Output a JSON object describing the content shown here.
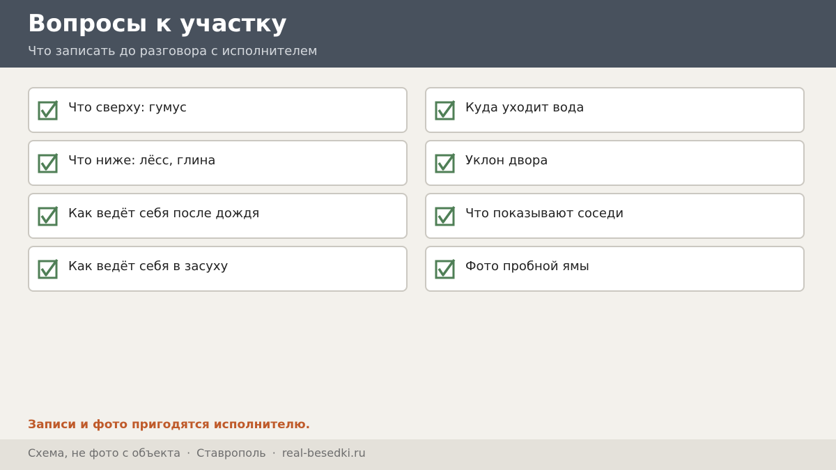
{
  "header": {
    "title": "Вопросы к участку",
    "subtitle": "Что записать до разговора с исполнителем"
  },
  "checklist": {
    "left": [
      {
        "label": "Что сверху: гумус",
        "checked": true
      },
      {
        "label": "Что ниже: лёсс, глина",
        "checked": true
      },
      {
        "label": "Как ведёт себя после дождя",
        "checked": true
      },
      {
        "label": "Как ведёт себя в засуху",
        "checked": true
      }
    ],
    "right": [
      {
        "label": "Куда уходит вода",
        "checked": true
      },
      {
        "label": "Уклон двора",
        "checked": true
      },
      {
        "label": "Что показывают соседи",
        "checked": true
      },
      {
        "label": "Фото пробной ямы",
        "checked": true
      }
    ],
    "check_icon": "checked-box-icon",
    "check_color": "#4f7f56"
  },
  "note": "Записи и фото пригодятся исполнителю.",
  "footer": {
    "caption": "Схема, не фото с объекта",
    "city": "Ставрополь",
    "site": "real-besedki.ru",
    "separator": "·"
  },
  "colors": {
    "header_bg": "#48515d",
    "page_bg": "#f3f1ec",
    "accent": "#bf5a2a"
  }
}
